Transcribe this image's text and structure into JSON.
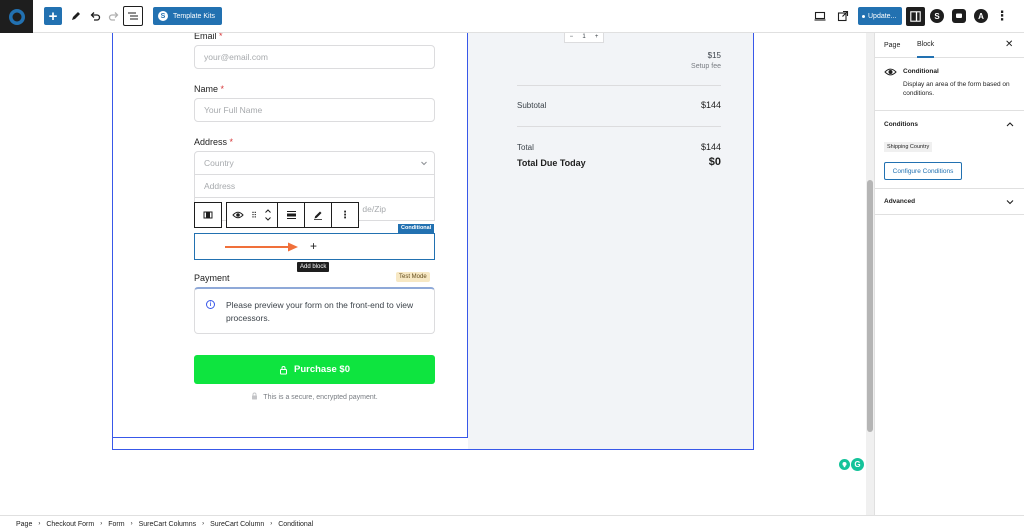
{
  "toolbar": {
    "template_kits_label": "Template Kits",
    "template_kits_icon": "S",
    "update_label": "Update...",
    "icons": [
      "add-block-icon",
      "pen-tool-icon",
      "undo-icon",
      "redo-icon",
      "document-outline-icon",
      "desktop-preview-icon",
      "external-view-icon",
      "settings-panel-icon"
    ],
    "plugin_icons": [
      "S",
      "A"
    ]
  },
  "form": {
    "email_label": "Email",
    "email_placeholder": "your@email.com",
    "name_label": "Name",
    "name_placeholder": "Your Full Name",
    "address_label": "Address",
    "required_mark": "*",
    "country_placeholder": "Country",
    "address_placeholder": "Address",
    "postal_partial": "de/Zip",
    "conditional_tag": "Conditional",
    "add_block_tooltip": "Add block",
    "add_block_symbol": "+",
    "payment_label": "Payment",
    "test_mode_badge": "Test Mode",
    "payment_notice": "Please preview your form on the front-end to view processors.",
    "purchase_button": "Purchase $0",
    "secure_text": "This is a secure, encrypted payment."
  },
  "summary": {
    "quantity": "1",
    "quantity_minus": "−",
    "quantity_plus": "+",
    "setup_fee_amount": "$15",
    "setup_fee_label": "Setup fee",
    "subtotal_label": "Subtotal",
    "subtotal_value": "$144",
    "total_label": "Total",
    "total_value": "$144",
    "due_today_label": "Total Due Today",
    "due_today_value": "$0"
  },
  "sidebar": {
    "tab_page": "Page",
    "tab_block": "Block",
    "block_title": "Conditional",
    "block_description": "Display an area of the form based on conditions.",
    "conditions_heading": "Conditions",
    "condition_tag": "Shipping Country",
    "configure_button": "Configure Conditions",
    "advanced_heading": "Advanced"
  },
  "breadcrumb": [
    "Page",
    "Checkout Form",
    "Form",
    "SureCart Columns",
    "SureCart Column",
    "Conditional"
  ],
  "colors": {
    "accent": "#2271b1",
    "selection": "#3858e9",
    "purchase": "#0ee43f",
    "arrow": "#f0703a"
  }
}
